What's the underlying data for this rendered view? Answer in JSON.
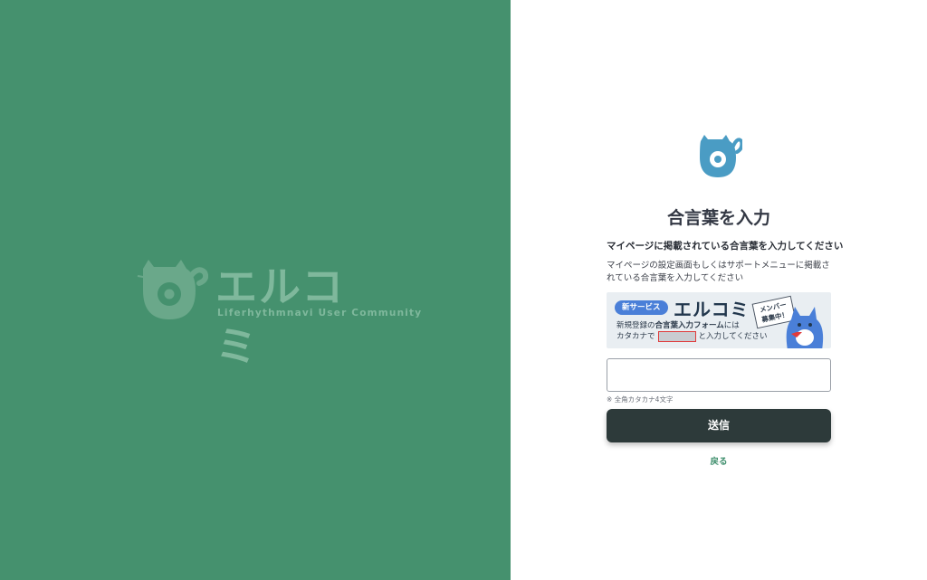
{
  "brand": {
    "name": "エルコミ",
    "tagline": "Liferhythmnavi User Community"
  },
  "form": {
    "title": "合言葉を入力",
    "subtitle": "マイページに掲載されている合言葉を入力してください",
    "description": "マイページの設定画面もしくはサポートメニューに掲載されている合言葉を入力してください",
    "input_value": "",
    "input_placeholder": "",
    "hint": "※ 全角カタカナ4文字",
    "submit_label": "送信",
    "back_label": "戻る"
  },
  "banner": {
    "pill": "新サービス",
    "name": "エルコミ",
    "line1_prefix": "新規登録の",
    "line1_bold": "合言葉入力フォーム",
    "line1_suffix": "には",
    "line2_prefix": "カタカナで",
    "line2_suffix": "と入力してください",
    "sign_line1": "メンバー",
    "sign_line2": "募集中！"
  },
  "colors": {
    "left_bg": "#45916e",
    "button_bg": "#2d3a3a",
    "link": "#3e8e6c",
    "logo": "#4a9cc4"
  }
}
